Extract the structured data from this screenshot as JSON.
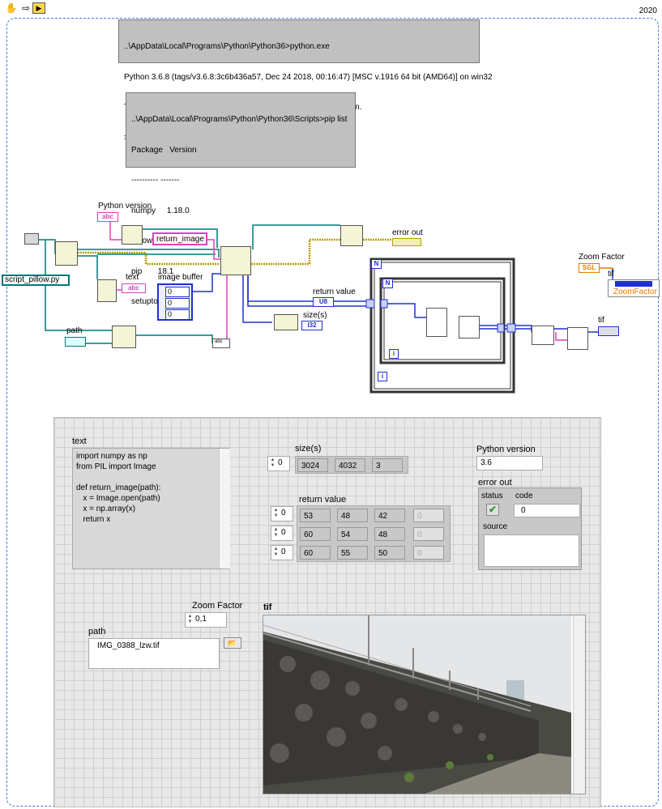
{
  "toolbar": {
    "icons": [
      "hand-icon",
      "arrow-icon",
      "run-icon"
    ],
    "year": "2020"
  },
  "console1": {
    "lines": [
      "..\\AppData\\Local\\Programs\\Python\\Python36>python.exe",
      "Python 3.6.8 (tags/v3.6.8:3c6b436a57, Dec 24 2018, 00:16:47) [MSC v.1916 64 bit (AMD64)] on win32",
      "Type \"help\", \"copyright\", \"credits\" or \"license\" for more information.",
      ">>> exit()"
    ]
  },
  "console2": {
    "lines": [
      "..\\AppData\\Local\\Programs\\Python\\Python36\\Scripts>pip list",
      "Package   Version",
      "---------- -------",
      "numpy     1.18.0",
      "Pillow    8.0.1",
      "pip       18.1",
      "setuptools 40.6.2"
    ]
  },
  "diagram": {
    "python_version_label": "Python version",
    "python_version_term": "abc",
    "return_image_label": "return_image",
    "error_out_label": "error out",
    "text_label": "text",
    "text_term": "abc",
    "image_buffer_label": "image buffer",
    "image_buffer_values": [
      "0",
      "0",
      "0"
    ],
    "script_label": "script_pillow.py",
    "path_label": "path",
    "return_value_label": "return value",
    "return_value_term": "U8",
    "size_label": "size(s)",
    "size_term": "I32",
    "loop_n": "N",
    "loop_i": "i",
    "zoom_factor_label": "Zoom Factor",
    "zoom_term": "SGL",
    "tif_label": "tif",
    "zoomfactor_property": "ZoomFactor",
    "tif_label2": "tif",
    "abc_small": "abc"
  },
  "panel": {
    "text": {
      "label": "text",
      "content": "import numpy as np\nfrom PIL import Image\n\ndef return_image(path):\n   x = Image.open(path)\n   x = np.array(x)\n   return x"
    },
    "size": {
      "label": "size(s)",
      "index": "0",
      "values": [
        "3024",
        "4032",
        "3"
      ]
    },
    "return_value": {
      "label": "return value",
      "rows": [
        {
          "index": "0",
          "values": [
            "53",
            "48",
            "42",
            "0"
          ]
        },
        {
          "index": "0",
          "values": [
            "60",
            "54",
            "48",
            "0"
          ]
        },
        {
          "index": "0",
          "values": [
            "60",
            "55",
            "50",
            "0"
          ]
        }
      ]
    },
    "python_version": {
      "label": "Python version",
      "value": "3.6"
    },
    "error_out": {
      "label": "error out",
      "status_label": "status",
      "code_label": "code",
      "code_value": "0",
      "source_label": "source"
    },
    "zoom_factor": {
      "label": "Zoom Factor",
      "value": "0,1"
    },
    "path": {
      "label": "path",
      "value": "IMG_0388_lzw.tif"
    },
    "tif": {
      "label": "tif"
    }
  },
  "colors": {
    "string_wire": "#e040c0",
    "error_wire": "#b8a000",
    "refnum_wire": "#007878",
    "numeric_wire": "#2030d0",
    "frame_border": "#3b7bd5",
    "status_ok": "#2e9e2e"
  }
}
